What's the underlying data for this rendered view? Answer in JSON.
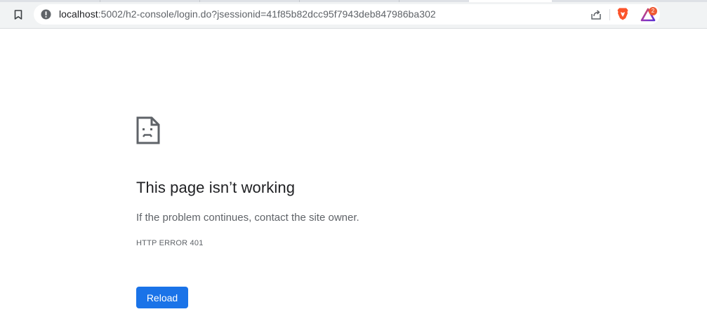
{
  "browser": {
    "url_host": "localhost",
    "url_rest": ":5002/h2-console/login.do?jsessionid=41f85b82dcc95f7943deb847986ba302",
    "rewards_badge_count": "2",
    "icons": {
      "bookmark": "bookmark-icon",
      "site_info": "site-info-warning-icon",
      "share": "share-icon",
      "shield": "brave-shield-icon",
      "rewards": "brave-rewards-icon"
    },
    "colors": {
      "toolbar_bg": "#f1f3f4",
      "shield_orange": "#fb542b",
      "badge_red": "#ef5a34"
    }
  },
  "error_page": {
    "icon": "sad-page-icon",
    "title": "This page isn’t working",
    "subtitle": "If the problem continues, contact the site owner.",
    "error_code": "HTTP ERROR 401",
    "reload_label": "Reload",
    "colors": {
      "button_bg": "#1a73e8",
      "title": "#202124",
      "body_text": "#5f6368"
    }
  }
}
